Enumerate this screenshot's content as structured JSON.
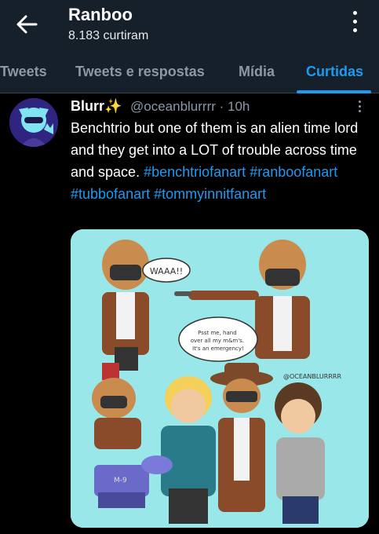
{
  "header": {
    "title": "Ranboo",
    "subtitle": "8.183 curtiram",
    "back_icon": "arrow-left-icon",
    "menu_icon": "more-vertical-icon"
  },
  "tabs": [
    {
      "label": "Tweets",
      "active": false
    },
    {
      "label": "Tweets e respostas",
      "active": false
    },
    {
      "label": "Mídia",
      "active": false
    },
    {
      "label": "Curtidas",
      "active": true
    }
  ],
  "tweet": {
    "author_name": "Blurr✨",
    "handle_time": "@oceanblurrrr · 10h",
    "text": "Benchtrio but one of them is an alien time lord and they get into a LOT of trouble across time and space.",
    "hashtags": [
      "#benchtriofanart",
      "#ranboofanart",
      "#tubbofanart",
      "#tommyinnitfanart"
    ],
    "media": {
      "speech_1": "WAAA!!",
      "speech_2": "Psst me, hand over all my m&m's. It's an emergency!",
      "credit": "@OCEANBLURRRR",
      "robot_label": "M-9"
    }
  },
  "colors": {
    "header_bg": "#15202b",
    "accent": "#1d9bf0",
    "muted": "#8b98a5",
    "media_bg": "#9ae7ea"
  }
}
